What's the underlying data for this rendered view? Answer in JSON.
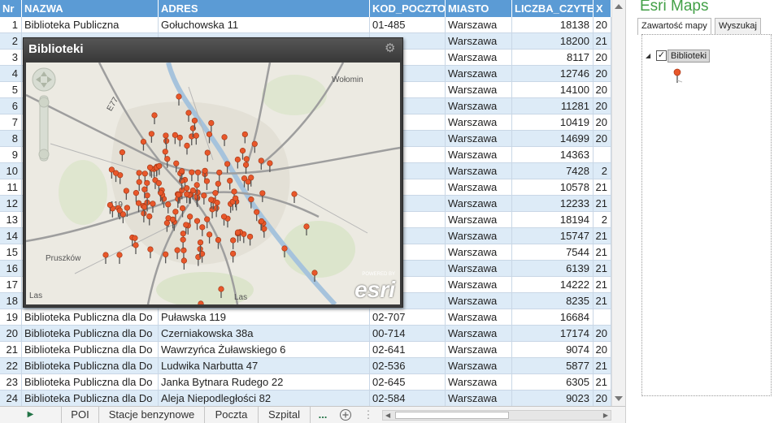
{
  "sheet": {
    "columns": [
      "Nr",
      "NAZWA",
      "ADRES",
      "KOD_POCZTOW",
      "MIASTO",
      "LICZBA_CZYTEL",
      "X"
    ],
    "rows": [
      {
        "nr": "1",
        "nazwa": "Biblioteka Publiczna",
        "adres": "Gołuchowska 11",
        "kod": "01-485",
        "miasto": "Warszawa",
        "liczba": "18138",
        "x": "20"
      },
      {
        "nr": "2",
        "nazwa": "",
        "adres": "",
        "kod": "",
        "miasto": "Warszawa",
        "liczba": "18200",
        "x": "21"
      },
      {
        "nr": "3",
        "nazwa": "",
        "adres": "",
        "kod": "",
        "miasto": "Warszawa",
        "liczba": "8117",
        "x": "20"
      },
      {
        "nr": "4",
        "nazwa": "",
        "adres": "",
        "kod": "",
        "miasto": "Warszawa",
        "liczba": "12746",
        "x": "20"
      },
      {
        "nr": "5",
        "nazwa": "",
        "adres": "",
        "kod": "",
        "miasto": "Warszawa",
        "liczba": "14100",
        "x": "20"
      },
      {
        "nr": "6",
        "nazwa": "",
        "adres": "",
        "kod": "",
        "miasto": "Warszawa",
        "liczba": "11281",
        "x": "20"
      },
      {
        "nr": "7",
        "nazwa": "",
        "adres": "",
        "kod": "",
        "miasto": "Warszawa",
        "liczba": "10419",
        "x": "20"
      },
      {
        "nr": "8",
        "nazwa": "",
        "adres": "",
        "kod": "",
        "miasto": "Warszawa",
        "liczba": "14699",
        "x": "20"
      },
      {
        "nr": "9",
        "nazwa": "",
        "adres": "",
        "kod": "",
        "miasto": "Warszawa",
        "liczba": "14363",
        "x": ""
      },
      {
        "nr": "10",
        "nazwa": "",
        "adres": "",
        "kod": "",
        "miasto": "Warszawa",
        "liczba": "7428",
        "x": "2"
      },
      {
        "nr": "11",
        "nazwa": "",
        "adres": "",
        "kod": "",
        "miasto": "Warszawa",
        "liczba": "10578",
        "x": "21"
      },
      {
        "nr": "12",
        "nazwa": "",
        "adres": "",
        "kod": "",
        "miasto": "Warszawa",
        "liczba": "12233",
        "x": "21"
      },
      {
        "nr": "13",
        "nazwa": "",
        "adres": "",
        "kod": "",
        "miasto": "Warszawa",
        "liczba": "18194",
        "x": "2"
      },
      {
        "nr": "14",
        "nazwa": "",
        "adres": "",
        "kod": "",
        "miasto": "Warszawa",
        "liczba": "15747",
        "x": "21"
      },
      {
        "nr": "15",
        "nazwa": "",
        "adres": "",
        "kod": "",
        "miasto": "Warszawa",
        "liczba": "7544",
        "x": "21"
      },
      {
        "nr": "16",
        "nazwa": "",
        "adres": "",
        "kod": "",
        "miasto": "Warszawa",
        "liczba": "6139",
        "x": "21"
      },
      {
        "nr": "17",
        "nazwa": "",
        "adres": "",
        "kod": "",
        "miasto": "Warszawa",
        "liczba": "14222",
        "x": "21"
      },
      {
        "nr": "18",
        "nazwa": "",
        "adres": "",
        "kod": "",
        "miasto": "Warszawa",
        "liczba": "8235",
        "x": "21"
      },
      {
        "nr": "19",
        "nazwa": "Biblioteka Publiczna dla Do",
        "adres": "Puławska 119",
        "kod": "02-707",
        "miasto": "Warszawa",
        "liczba": "16684",
        "x": ""
      },
      {
        "nr": "20",
        "nazwa": "Biblioteka Publiczna dla Do",
        "adres": "Czerniakowska 38a",
        "kod": "00-714",
        "miasto": "Warszawa",
        "liczba": "17174",
        "x": "20"
      },
      {
        "nr": "21",
        "nazwa": "Biblioteka Publiczna dla Do",
        "adres": "Wawrzyńca Żuławskiego 6",
        "kod": "02-641",
        "miasto": "Warszawa",
        "liczba": "9074",
        "x": "20"
      },
      {
        "nr": "22",
        "nazwa": "Biblioteka Publiczna dla Do",
        "adres": "Ludwika Narbutta 47",
        "kod": "02-536",
        "miasto": "Warszawa",
        "liczba": "5877",
        "x": "21"
      },
      {
        "nr": "23",
        "nazwa": "Biblioteka Publiczna dla Do",
        "adres": "Janka Bytnara Rudego 22",
        "kod": "02-645",
        "miasto": "Warszawa",
        "liczba": "6305",
        "x": "21"
      },
      {
        "nr": "24",
        "nazwa": "Biblioteka Publiczna dla Do",
        "adres": "Aleja Niepodległości 82",
        "kod": "02-584",
        "miasto": "Warszawa",
        "liczba": "9023",
        "x": "20"
      }
    ]
  },
  "map": {
    "title": "Biblioteki",
    "labels": {
      "wolomin": "Wołomin",
      "pruszkow": "Pruszków",
      "e77": "E77",
      "n119": "119",
      "las1": "Las",
      "las2": "Las"
    },
    "powered_by": "POWERED BY",
    "esri": "esri",
    "pin_color": "#e8572a"
  },
  "tabs": {
    "items": [
      "POI",
      "Stacje benzynowe",
      "Poczta",
      "Szpital"
    ],
    "more": "...",
    "add": "+"
  },
  "panel": {
    "title": "Esri Maps",
    "tab_contents": "Zawartość mapy",
    "tab_search": "Wyszukaj",
    "layer_name": "Biblioteki",
    "layer_checked": "✓"
  }
}
